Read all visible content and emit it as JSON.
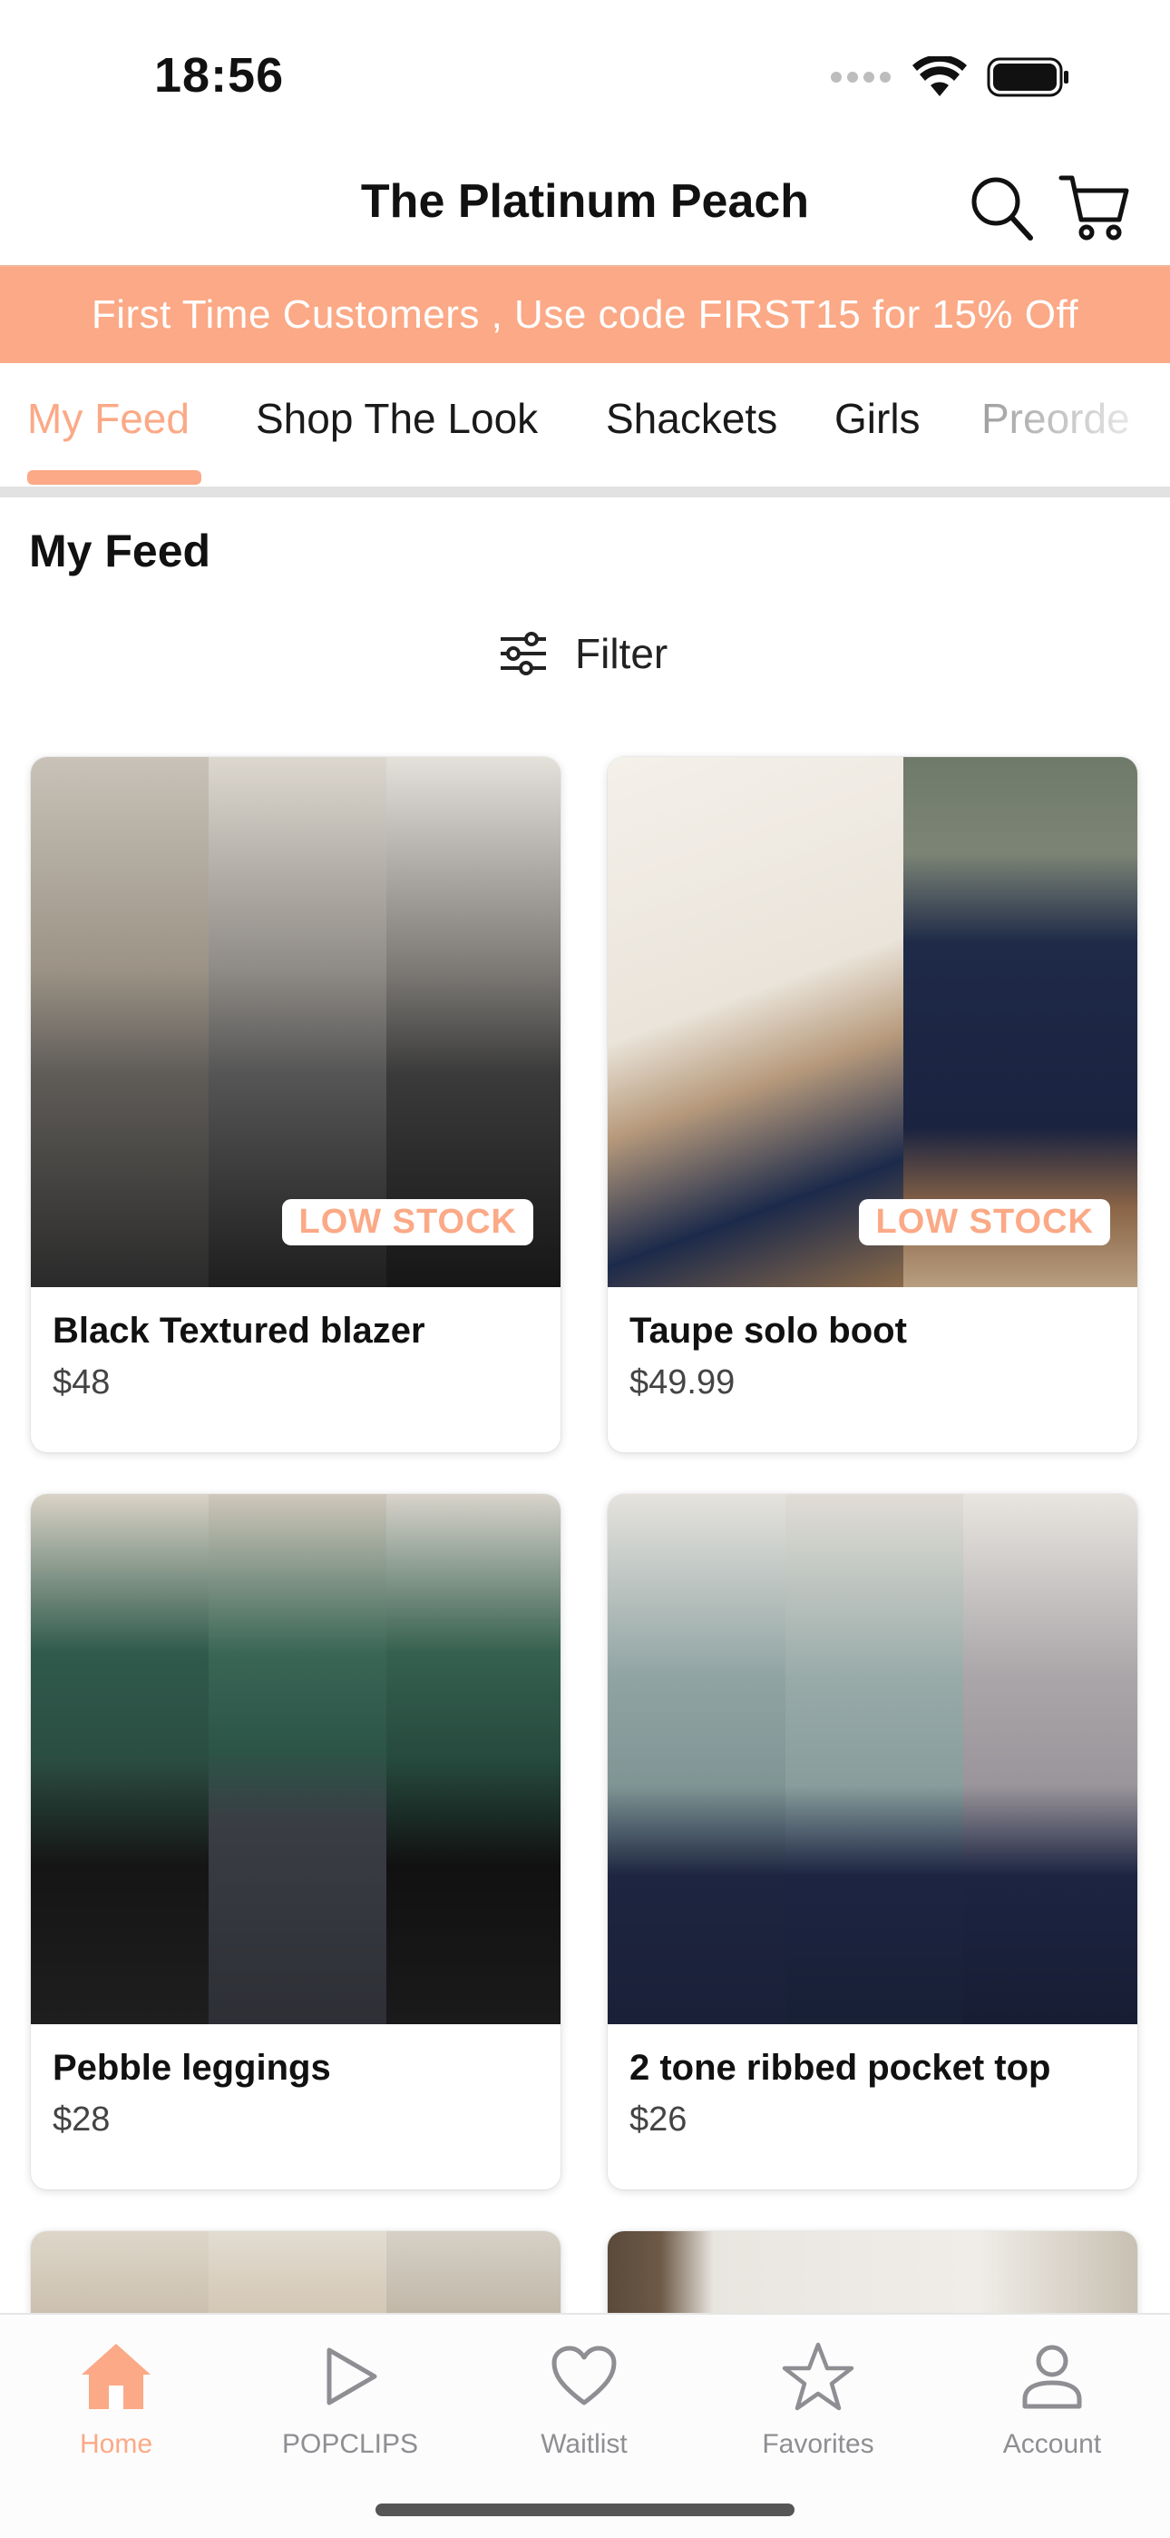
{
  "status": {
    "time": "18:56"
  },
  "header": {
    "title": "The Platinum Peach"
  },
  "promo": {
    "text": "First Time Customers , Use code FIRST15 for 15% Off"
  },
  "tabs": [
    {
      "label": "My Feed",
      "active": true
    },
    {
      "label": "Shop The Look"
    },
    {
      "label": "Shackets"
    },
    {
      "label": "Girls"
    },
    {
      "label": "Preorde"
    }
  ],
  "section": {
    "title": "My Feed",
    "filter_label": "Filter"
  },
  "products": [
    {
      "name": "Black Textured blazer",
      "price": "$48",
      "badge": "LOW STOCK"
    },
    {
      "name": "Taupe solo boot",
      "price": "$49.99",
      "badge": "LOW STOCK"
    },
    {
      "name": "Pebble leggings",
      "price": "$28"
    },
    {
      "name": "2 tone ribbed pocket top",
      "price": "$26"
    }
  ],
  "bottom_nav": [
    {
      "label": "Home",
      "icon": "home-icon",
      "active": true
    },
    {
      "label": "POPCLIPS",
      "icon": "play-icon"
    },
    {
      "label": "Waitlist",
      "icon": "heart-icon"
    },
    {
      "label": "Favorites",
      "icon": "star-icon"
    },
    {
      "label": "Account",
      "icon": "person-icon"
    }
  ],
  "colors": {
    "accent": "#fba986",
    "promo_bg": "#fba986",
    "inactive_nav": "#8e8e93"
  }
}
